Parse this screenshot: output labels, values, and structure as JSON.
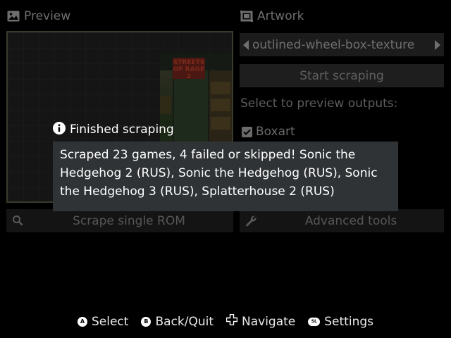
{
  "preview": {
    "header": "Preview",
    "header_icon": "image-icon",
    "art_logo_text": "STREETS OF RAGE 2"
  },
  "artwork": {
    "header": "Artwork",
    "header_icon": "frame-icon",
    "selected_output": "outlined-wheel-box-texture",
    "start_button": "Start scraping",
    "select_hint": "Select to preview outputs:",
    "checkbox_label": "Boxart",
    "checkbox_checked": true
  },
  "actions": {
    "scrape_single": "Scrape single ROM",
    "scrape_single_icon": "search-icon",
    "advanced": "Advanced tools",
    "advanced_icon": "wrench-icon"
  },
  "dialog": {
    "title": "Finished scraping",
    "icon": "info-icon",
    "message": "Scraped 23 games, 4 failed or skipped! Sonic the Hedgehog 2 (RUS), Sonic the Hedgehog (RUS), Sonic the Hedgehog 3 (RUS), Splatterhouse 2 (RUS)"
  },
  "footer": [
    {
      "glyph": "A",
      "label": "Select"
    },
    {
      "glyph": "B",
      "label": "Back/Quit"
    },
    {
      "glyph": "dpad",
      "label": "Navigate"
    },
    {
      "glyph": "SL",
      "label": "Settings"
    }
  ],
  "colors": {
    "background": "#000000",
    "dialog_bg": "#2f3336",
    "dim_text": "#6f6f6f",
    "bright_text": "#ffffff"
  }
}
